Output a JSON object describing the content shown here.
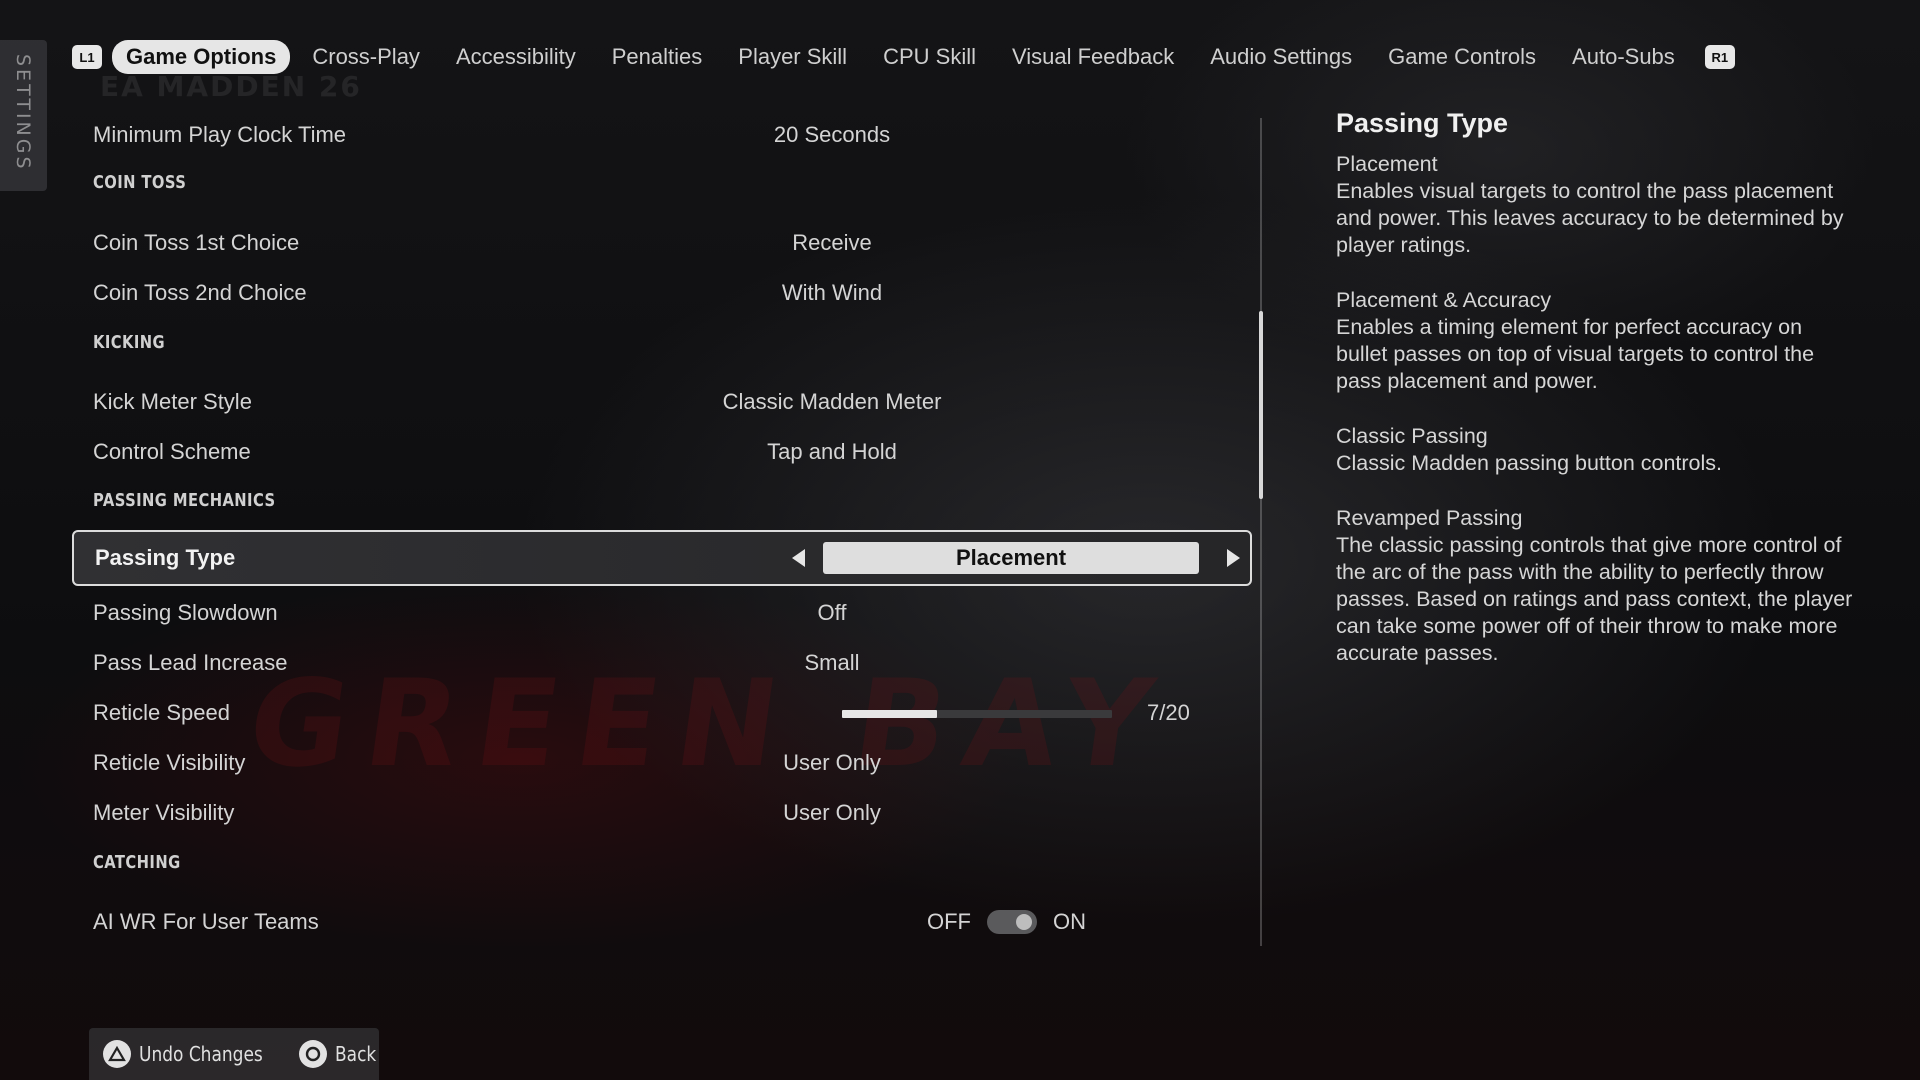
{
  "side_tab": {
    "label": "SETTINGS"
  },
  "background": {
    "logo": "EA MADDEN 26",
    "watermark": "GREEN BAY"
  },
  "tabbar": {
    "left_shoulder": "L1",
    "right_shoulder": "R1",
    "tabs": [
      {
        "label": "Game Options",
        "active": true
      },
      {
        "label": "Cross-Play"
      },
      {
        "label": "Accessibility"
      },
      {
        "label": "Penalties"
      },
      {
        "label": "Player Skill"
      },
      {
        "label": "CPU Skill"
      },
      {
        "label": "Visual Feedback"
      },
      {
        "label": "Audio Settings"
      },
      {
        "label": "Game Controls"
      },
      {
        "label": "Auto-Subs"
      }
    ]
  },
  "settings": {
    "min_play_clock": {
      "label": "Minimum Play Clock Time",
      "value": "20 Seconds"
    },
    "coin_toss_header": "COIN TOSS",
    "coin_toss_1st": {
      "label": "Coin Toss 1st Choice",
      "value": "Receive"
    },
    "coin_toss_2nd": {
      "label": "Coin Toss 2nd Choice",
      "value": "With Wind"
    },
    "kicking_header": "KICKING",
    "kick_meter_style": {
      "label": "Kick Meter Style",
      "value": "Classic Madden Meter"
    },
    "control_scheme": {
      "label": "Control Scheme",
      "value": "Tap and Hold"
    },
    "passing_header": "PASSING MECHANICS",
    "passing_type": {
      "label": "Passing Type",
      "value": "Placement"
    },
    "passing_slowdown": {
      "label": "Passing Slowdown",
      "value": "Off"
    },
    "pass_lead_increase": {
      "label": "Pass Lead Increase",
      "value": "Small"
    },
    "reticle_speed": {
      "label": "Reticle Speed",
      "value_text": "7/20",
      "value": 7,
      "max": 20
    },
    "reticle_visibility": {
      "label": "Reticle Visibility",
      "value": "User Only"
    },
    "meter_visibility": {
      "label": "Meter Visibility",
      "value": "User Only"
    },
    "catching_header": "CATCHING",
    "ai_wr": {
      "label": "AI WR For User Teams",
      "off_label": "OFF",
      "on_label": "ON",
      "state": "on"
    }
  },
  "description": {
    "title": "Passing Type",
    "options": [
      {
        "name": "Placement",
        "text": "Enables visual targets to control the pass placement and power. This leaves accuracy to be determined by player ratings."
      },
      {
        "name": "Placement & Accuracy",
        "text": "Enables a timing element for perfect accuracy on bullet passes on top of visual targets to control the pass placement and power."
      },
      {
        "name": "Classic Passing",
        "text": "Classic Madden passing button controls."
      },
      {
        "name": "Revamped Passing",
        "text": "The classic passing controls that give more control of the arc of the pass with the ability to perfectly throw passes. Based on ratings and pass context, the player can take some power off of their throw to make more accurate passes."
      }
    ]
  },
  "bottom_bar": {
    "undo": {
      "label": "Undo Changes",
      "icon": "triangle-icon"
    },
    "back": {
      "label": "Back",
      "icon": "circle-icon"
    }
  },
  "colors": {
    "accent": "#e6e6e6",
    "background": "#0d0d0f",
    "text": "#d4d4d4",
    "selected_border": "#dcdcdc"
  }
}
